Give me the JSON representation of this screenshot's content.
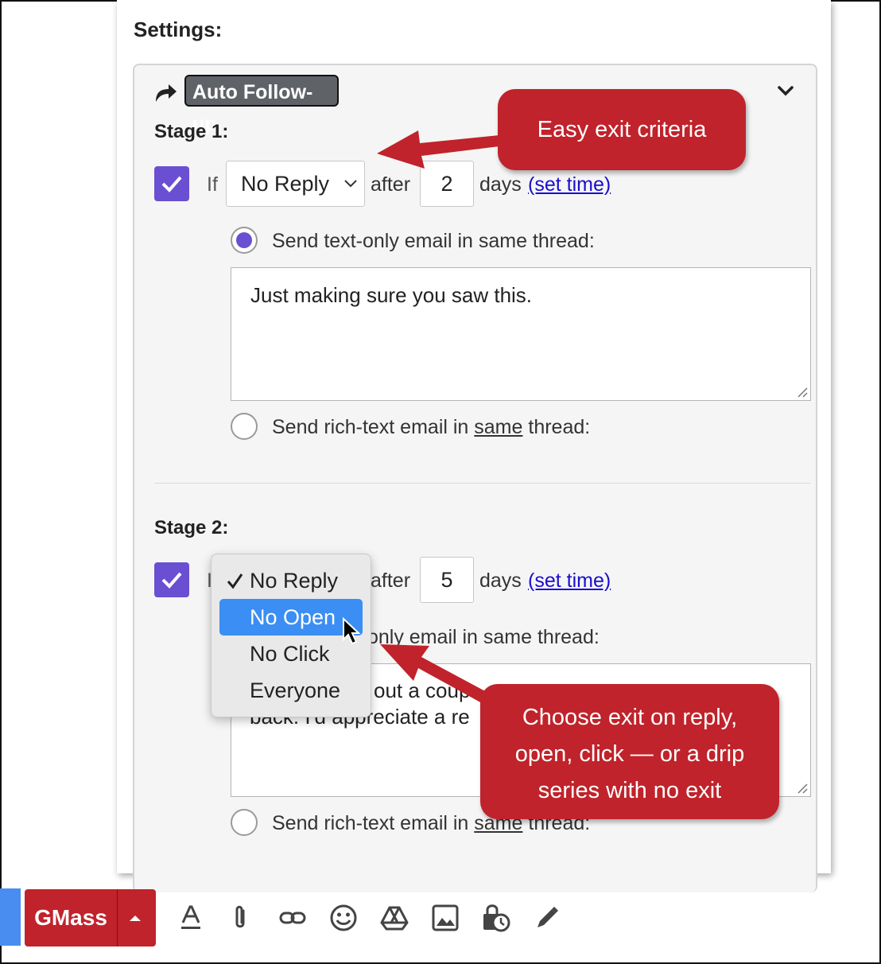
{
  "settings_title": "Settings:",
  "auto_followup": {
    "label": "Auto Follow-up"
  },
  "stage1": {
    "label": "Stage 1:",
    "if_label": "If",
    "condition": "No Reply",
    "after_label": "after",
    "days_value": "2",
    "days_label": "days",
    "set_time_link": "(set time)",
    "option_text": "Send text-only email in same thread:",
    "message": "Just making sure you saw this.",
    "option_rich_prefix": "Send rich-text email in ",
    "option_rich_emph": "same",
    "option_rich_suffix": " thread:"
  },
  "stage2": {
    "label": "Stage 2:",
    "if_label": "I",
    "after_label": "after",
    "days_value": "5",
    "days_label": "days",
    "set_time_link": "(set time)",
    "option_text_visible": "only email in same thread:",
    "message_line1": "out a coup",
    "message_line2": "back. I'd appreciate a re",
    "option_rich_prefix": "Send rich-text email in ",
    "option_rich_emph": "same",
    "option_rich_suffix": " thread:"
  },
  "dropdown": {
    "options": [
      "No Reply",
      "No Open",
      "No Click",
      "Everyone"
    ],
    "checked": "No Reply",
    "highlighted": "No Open"
  },
  "callouts": {
    "top": "Easy exit criteria",
    "bottom_line1": "Choose exit on reply,",
    "bottom_line2": "open, click — or a drip",
    "bottom_line3": "series with no exit"
  },
  "toolbar": {
    "gmass_label": "GMass",
    "icons": [
      "text-format-icon",
      "attach-icon",
      "link-icon",
      "emoji-icon",
      "drive-icon",
      "photo-icon",
      "schedule-lock-icon",
      "signature-pen-icon"
    ]
  },
  "colors": {
    "accent": "#6a4fd2",
    "callout": "#c0232b",
    "select_highlight": "#3b8ef3",
    "link": "#1a0dcc"
  }
}
